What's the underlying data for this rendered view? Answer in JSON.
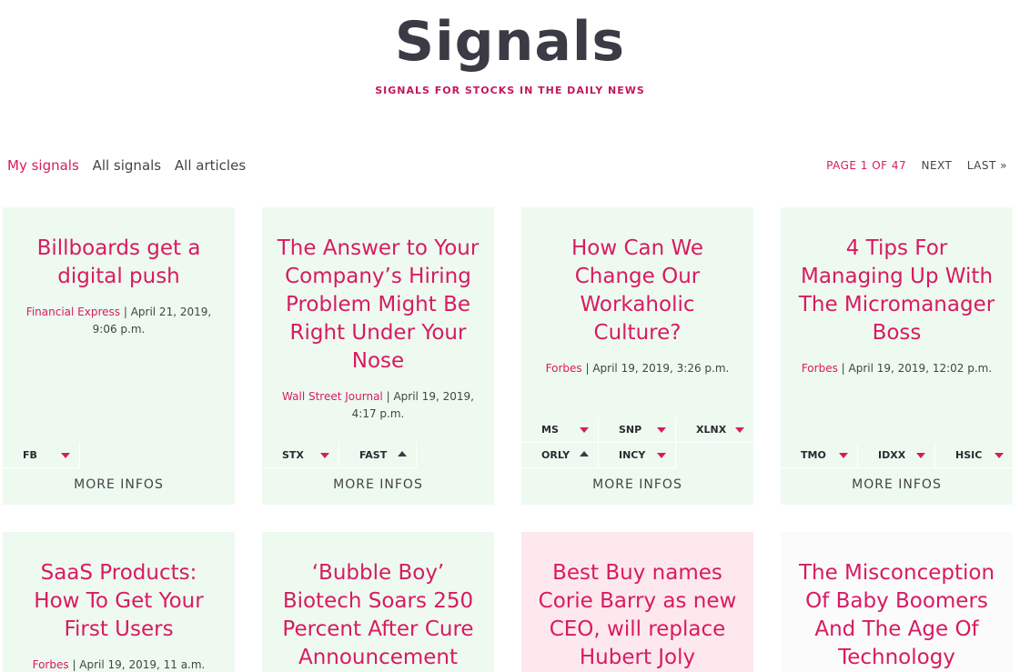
{
  "header": {
    "title": "Signals",
    "tagline": "SIGNALS FOR STOCKS IN THE DAILY NEWS"
  },
  "filters": [
    "My signals",
    "All signals",
    "All articles"
  ],
  "pager": {
    "page_info": "PAGE 1 OF 47",
    "next": "NEXT",
    "last": "LAST »"
  },
  "colors": {
    "accent": "#d81b60",
    "card_green": "#eefaf0",
    "card_pink": "#fde8ee",
    "title_dark": "#3a3b45"
  },
  "more_label": "MORE INFOS",
  "cards": [
    {
      "title": "Billboards get a digital push",
      "source": "Financial Express",
      "date": " | April 21, 2019, 9:06 p.m.",
      "tickers": [
        [
          "FB"
        ]
      ],
      "directions": [
        [
          "down"
        ]
      ]
    },
    {
      "title": "The Answer to Your Company’s Hiring Problem Might Be Right Under Your Nose",
      "source": "Wall Street Journal",
      "date": " | April 19, 2019, 4:17 p.m.",
      "tickers": [
        [
          "STX",
          "FAST"
        ]
      ],
      "directions": [
        [
          "down",
          "up"
        ]
      ]
    },
    {
      "title": "How Can We Change Our Workaholic Culture?",
      "source": "Forbes",
      "date": " | April 19, 2019, 3:26 p.m.",
      "tickers": [
        [
          "MS",
          "SNP",
          "XLNX"
        ],
        [
          "ORLY",
          "INCY"
        ]
      ],
      "directions": [
        [
          "down",
          "down",
          "down"
        ],
        [
          "up",
          "down"
        ]
      ]
    },
    {
      "title": "4 Tips For Managing Up With The Micromanager Boss",
      "source": "Forbes",
      "date": " | April 19, 2019, 12:02 p.m.",
      "tickers": [
        [
          "TMO",
          "IDXX",
          "HSIC"
        ]
      ],
      "directions": [
        [
          "down",
          "down",
          "down"
        ]
      ]
    },
    {
      "title": "SaaS Products: How To Get Your First Users",
      "source": "Forbes",
      "date": " | April 19, 2019, 11 a.m."
    },
    {
      "title": "‘Bubble Boy’ Biotech Soars 250 Percent After Cure Announcement"
    },
    {
      "title": "Best Buy names Corie Barry as new CEO, will replace Hubert Joly"
    },
    {
      "title": "The Misconception Of Baby Boomers And The Age Of Technology"
    }
  ]
}
